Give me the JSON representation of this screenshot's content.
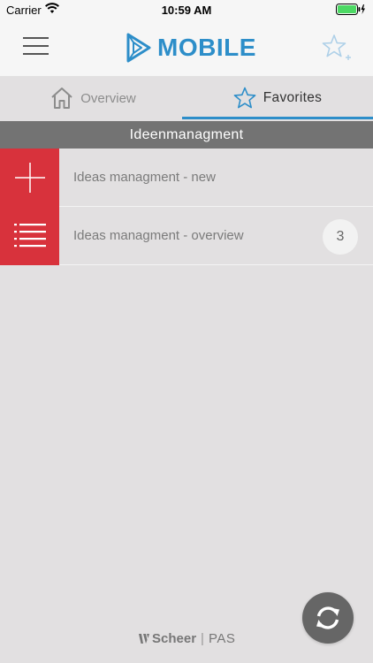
{
  "status_bar": {
    "carrier": "Carrier",
    "time": "10:59 AM"
  },
  "header": {
    "logo_text": "MOBILE",
    "menu_icon": "hamburger-menu-icon",
    "favorite_icon": "star-add-icon"
  },
  "tabs": [
    {
      "label": "Overview",
      "icon": "home-icon",
      "active": false
    },
    {
      "label": "Favorites",
      "icon": "star-icon",
      "active": true
    }
  ],
  "section": {
    "title": "Ideenmanagment"
  },
  "items": [
    {
      "label": "Ideas managment - new",
      "icon": "plus-icon",
      "badge": ""
    },
    {
      "label": "Ideas managment - overview",
      "icon": "list-icon",
      "badge": "3"
    }
  ],
  "footer": {
    "brand": "Scheer",
    "separator": "|",
    "product": "PAS"
  },
  "colors": {
    "accent": "#2d8ec9",
    "item_icon_bg": "#d8323c",
    "section_bg": "#737373",
    "page_bg": "#e2e0e1"
  }
}
